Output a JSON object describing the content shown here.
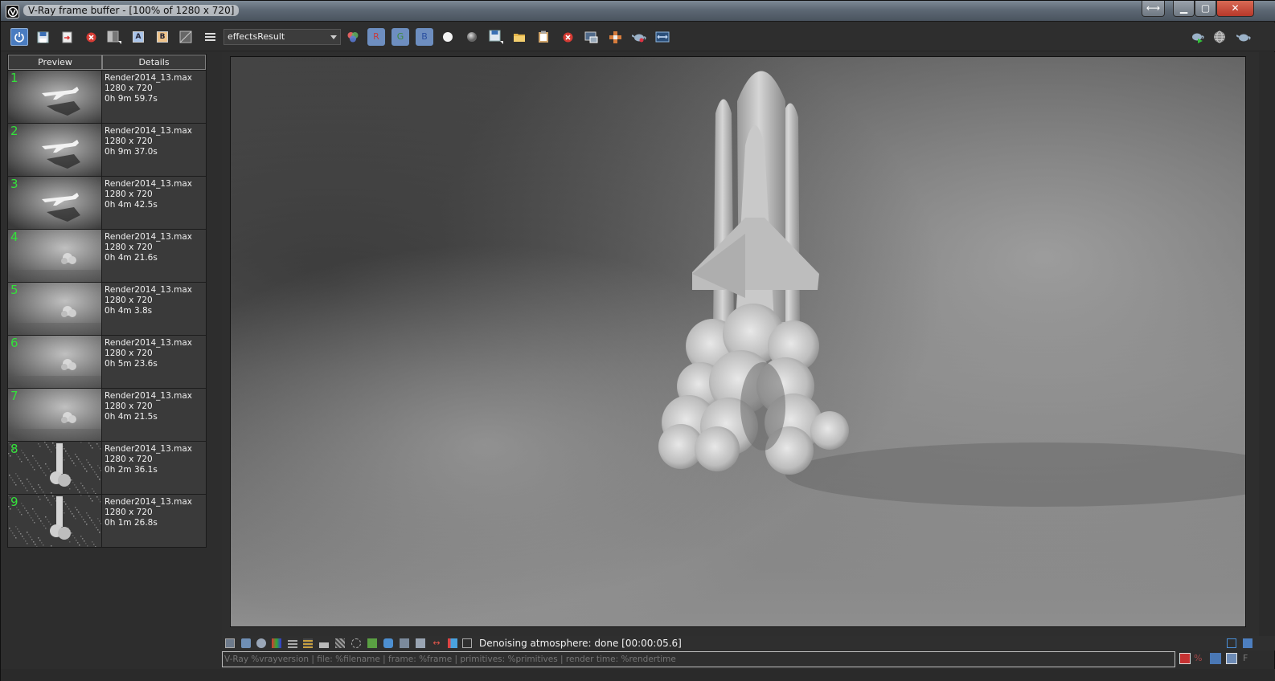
{
  "window": {
    "title": "V-Ray frame buffer - [100% of 1280 x 720]"
  },
  "toolbar": {
    "render_element_select": "effectsResult",
    "channel_r": "R",
    "channel_g": "G",
    "channel_b": "B",
    "compare_a": "A",
    "compare_b": "B",
    "icons": [
      "power-icon",
      "save-icon",
      "load-icon",
      "clear-icon",
      "compare-icon",
      "a-icon",
      "b-icon",
      "image-icon",
      "menu-icon",
      "color-channels-icon",
      "white-sphere-icon",
      "gray-sphere-icon",
      "save-image-icon",
      "open-folder-icon",
      "clipboard-icon",
      "stop-icon",
      "region-icon",
      "track-mouse-icon",
      "teapot-icon",
      "lens-icon",
      "render-teapot-icon",
      "globe-icon",
      "teapot-right-icon"
    ]
  },
  "history": {
    "col_preview": "Preview",
    "col_details": "Details",
    "items": [
      {
        "num": "1",
        "file": "Render2014_13.max",
        "res": "1280 x 720",
        "time": "0h 9m 59.7s",
        "kind": "plane"
      },
      {
        "num": "2",
        "file": "Render2014_13.max",
        "res": "1280 x 720",
        "time": "0h 9m 37.0s",
        "kind": "plane"
      },
      {
        "num": "3",
        "file": "Render2014_13.max",
        "res": "1280 x 720",
        "time": "0h 4m 42.5s",
        "kind": "plane"
      },
      {
        "num": "4",
        "file": "Render2014_13.max",
        "res": "1280 x 720",
        "time": "0h 4m 21.6s",
        "kind": "smoke"
      },
      {
        "num": "5",
        "file": "Render2014_13.max",
        "res": "1280 x 720",
        "time": "0h 4m 3.8s",
        "kind": "smoke"
      },
      {
        "num": "6",
        "file": "Render2014_13.max",
        "res": "1280 x 720",
        "time": "0h 5m 23.6s",
        "kind": "smoke"
      },
      {
        "num": "7",
        "file": "Render2014_13.max",
        "res": "1280 x 720",
        "time": "0h 4m 21.5s",
        "kind": "smoke"
      },
      {
        "num": "8",
        "file": "Render2014_13.max",
        "res": "1280 x 720",
        "time": "0h 2m 36.1s",
        "kind": "noisy"
      },
      {
        "num": "9",
        "file": "Render2014_13.max",
        "res": "1280 x 720",
        "time": "0h 1m 26.8s",
        "kind": "noisy"
      }
    ]
  },
  "status": {
    "message": "Denoising atmosphere: done [00:00:05.6]"
  },
  "caption": {
    "placeholder": "V-Ray %vrayversion | file: %filename | frame: %frame | primitives: %primitives | render time: %rendertime"
  },
  "colors": {
    "accent_blue": "#4a7cc0",
    "history_number": "#33e13a",
    "panel_bg": "#2d2d2d"
  }
}
